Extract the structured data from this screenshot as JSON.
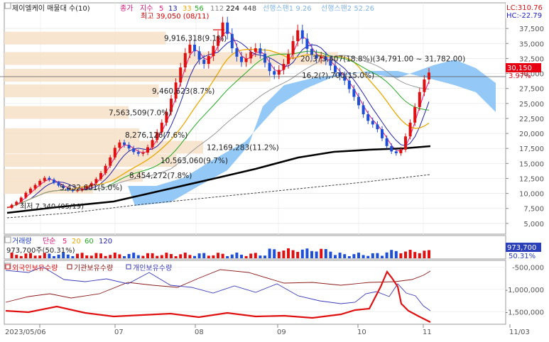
{
  "chart_data": [
    {
      "type": "line",
      "title": "제이엘케이 매물대 수(10)",
      "legend": {
        "close_label": "종가",
        "ma_label": "지수",
        "ma_periods": [
          "5",
          "13",
          "33",
          "56",
          "112",
          "224",
          "448"
        ],
        "ma_colors": [
          "#e8147c",
          "#2222aa",
          "#e8a800",
          "#22aa22",
          "#888888",
          "#000000",
          "#444444"
        ],
        "span1_label": "선행스팬1 9.26",
        "span2_label": "선행스팬2 52.26"
      },
      "badges": {
        "lc": "LC:310.76",
        "hc": "HC:-22.79",
        "price": "30,150",
        "pct": "3.97%"
      },
      "ylim": [
        3000,
        39000
      ],
      "y_ticks": [
        "5,000",
        "7,500",
        "10,000",
        "12,500",
        "15,000",
        "17,500",
        "20,000",
        "22,500",
        "25,000",
        "27,500",
        "30,000",
        "32,500",
        "35,000",
        "37,500"
      ],
      "y_tick_values": [
        5000,
        7500,
        10000,
        12500,
        15000,
        17500,
        20000,
        22500,
        25000,
        27500,
        30000,
        32500,
        35000,
        37500
      ],
      "x_ticks": [
        "2023/05/06",
        "07",
        "08",
        "09",
        "10",
        "11",
        "11/03"
      ],
      "close": [
        7600,
        8100,
        8600,
        9300,
        10100,
        10800,
        11400,
        12100,
        12600,
        12300,
        11800,
        11300,
        10900,
        10600,
        10400,
        10500,
        10800,
        11200,
        11700,
        12400,
        13400,
        14600,
        16000,
        17600,
        18500,
        18100,
        17500,
        16900,
        16600,
        16800,
        17700,
        18900,
        20200,
        21800,
        23600,
        25800,
        28500,
        31000,
        33400,
        34800,
        33700,
        32300,
        31600,
        32900,
        34600,
        36200,
        38500,
        36600,
        34200,
        32800,
        31900,
        32500,
        33600,
        34200,
        33300,
        31800,
        30400,
        29800,
        30600,
        31600,
        33200,
        35400,
        37200,
        35800,
        34100,
        33100,
        32500,
        32800,
        32200,
        31300,
        30200,
        29600,
        28800,
        27400,
        26100,
        24700,
        23200,
        22100,
        21500,
        20700,
        19200,
        17900,
        17000,
        16700,
        17300,
        19500,
        21800,
        24400,
        26900,
        29000,
        30150
      ],
      "volume_profile": [
        {
          "label": "5,432,601(5.0%)",
          "price": 11000,
          "share": 0.5
        },
        {
          "label": "8,454,272(7.8%)",
          "price": 13000,
          "share": 0.78
        },
        {
          "label": "10,563,060(9.7%)",
          "price": 15500,
          "share": 0.97
        },
        {
          "label": "12,169,283(11.2%)",
          "price": 17700,
          "share": 1.12
        },
        {
          "label": "8,276,126(7.6%)",
          "price": 19800,
          "share": 0.76
        },
        {
          "label": "7,563,509(7.0%)",
          "price": 23500,
          "share": 0.7
        },
        {
          "label": "9,460,623(8.7%)",
          "price": 27100,
          "share": 0.87
        },
        {
          "label": "16,2(?),700(15.0%)",
          "price": 29700,
          "share": 1.5
        },
        {
          "label": "20,373,407(18.8%)(34,791.00 ~ 31,782.00)",
          "price": 32500,
          "share": 1.88
        },
        {
          "label": "9,916,318(9.1%)",
          "price": 35900,
          "share": 0.91
        }
      ],
      "annotations": {
        "high": "최고 39,050 (08/11)",
        "low": "최저 7,340 (05/19)"
      }
    },
    {
      "type": "bar",
      "title": "거래량",
      "legend": {
        "label": "거래량",
        "ma_label": "단순",
        "ma_periods": [
          "5",
          "20",
          "60",
          "120"
        ],
        "ma_colors": [
          "#e8147c",
          "#e8a800",
          "#22aa22",
          "#2222aa"
        ]
      },
      "readout": "973,700주(50.31%)",
      "badges": {
        "volume": "973,700",
        "pct": "50.31%"
      }
    },
    {
      "type": "line",
      "title": "보유수량",
      "series": [
        {
          "name": "외국인보유수량",
          "color": "#e01010"
        },
        {
          "name": "기관보유수량",
          "color": "#8b1a1a"
        },
        {
          "name": "개인보유수량",
          "color": "#3a3ab8"
        }
      ],
      "y_ticks": [
        "-500,000",
        "-1,000,000",
        "-1,500,000"
      ],
      "y_tick_values": [
        -500000,
        -1000000,
        -1500000
      ],
      "ylim": [
        -1750000,
        -400000
      ]
    }
  ]
}
